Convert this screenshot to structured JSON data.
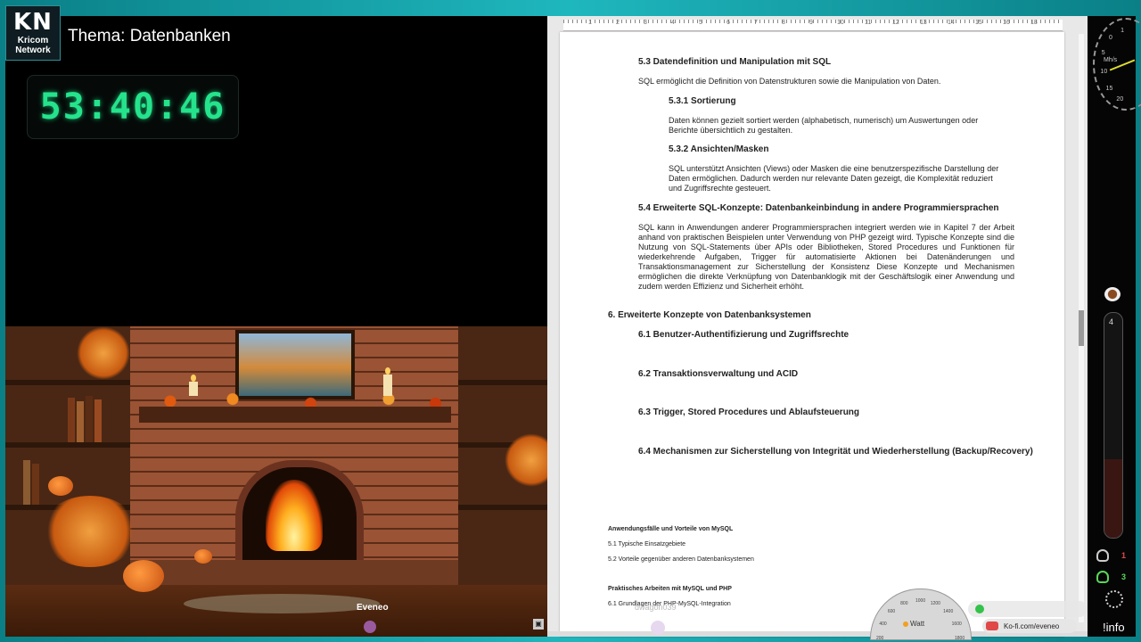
{
  "header": {
    "logo_main": "KN",
    "logo_sub1": "Kricom",
    "logo_sub2": "Network",
    "theme": "Thema: Datenbanken",
    "timer": "53:40:46"
  },
  "stream": {
    "scene_caption": "Eveneo",
    "ghost_name": "dwagon039"
  },
  "document": {
    "ruler_numbers": [
      "1",
      "2",
      "3",
      "4",
      "5",
      "6",
      "7",
      "8",
      "9",
      "10",
      "11",
      "12",
      "13",
      "14",
      "15",
      "16",
      "18"
    ],
    "s53_title": "5.3 Datendefinition und Manipulation mit SQL",
    "s53_text": "SQL ermöglicht die Definition von Datenstrukturen sowie die Manipulation von Daten.",
    "s531_title": "5.3.1 Sortierung",
    "s531_text": "Daten können gezielt sortiert werden (alphabetisch, numerisch) um Auswertungen oder Berichte übersichtlich zu gestalten.",
    "s532_title": "5.3.2 Ansichten/Masken",
    "s532_text": "SQL unterstützt Ansichten (Views) oder Masken die eine benutzerspezifische Darstellung der Daten ermöglichen. Dadurch werden nur relevante Daten gezeigt, die Komplexität reduziert und Zugriffsrechte gesteuert.",
    "s54_title": "5.4 Erweiterte SQL-Konzepte: Datenbankeinbindung in andere Programmiersprachen",
    "s54_text": "SQL kann in Anwendungen anderer Programmiersprachen integriert werden wie in Kapitel 7 der Arbeit anhand von praktischen Beispielen unter Verwendung von PHP gezeigt wird. Typische Konzepte sind die Nutzung von SQL-Statements über APIs oder Bibliotheken, Stored Procedures und Funktionen für wiederkehrende Aufgaben, Trigger für automatisierte Aktionen bei Datenänderungen und Transaktionsmanagement zur Sicherstellung der Konsistenz Diese Konzepte und Mechanismen ermöglichen die direkte Verknüpfung von Datenbanklogik mit der Geschäftslogik einer Anwendung und zudem werden Effizienz und Sicherheit erhöht.",
    "s6_title": "6. Erweiterte Konzepte von Datenbanksystemen",
    "s61_title": "6.1 Benutzer-Authentifizierung und Zugriffsrechte",
    "s62_title": "6.2 Transaktionsverwaltung und ACID",
    "s63_title": "6.3 Trigger, Stored Procedures und Ablaufsteuerung",
    "s64_title": "6.4 Mechanismen zur Sicherstellung von Integrität und Wiederherstellung (Backup/Recovery)",
    "n1_title": "Anwendungsfälle und Vorteile von MySQL",
    "n1_a": "5.1 Typische Einsatzgebiete",
    "n1_b": "5.2 Vorteile gegenüber anderen Datenbanksystemen",
    "n2_title": "Praktisches Arbeiten mit MySQL und PHP",
    "n2_a": "6.1 Grundlagen der PHP-MySQL-Integration"
  },
  "sidebar": {
    "gauge_label": "Mh/s",
    "gauge_ticks": [
      "1",
      "0",
      "5",
      "10",
      "15",
      "20"
    ],
    "tube_value": "4",
    "tube_fill": 0.35,
    "viewers_a": "1",
    "viewers_b": "3",
    "info": "!info"
  },
  "overlay": {
    "watt_label": "Watt",
    "watt_scale": [
      "200",
      "400",
      "600",
      "800",
      "1000",
      "1200",
      "1400",
      "1600",
      "1800"
    ],
    "kofi": "Ko-fi.com/eveneo"
  },
  "colors": {
    "accent": "#1fb7be",
    "timer": "#25e38c",
    "viewer_green": "#5ad65a",
    "viewer_red": "#e04848"
  }
}
